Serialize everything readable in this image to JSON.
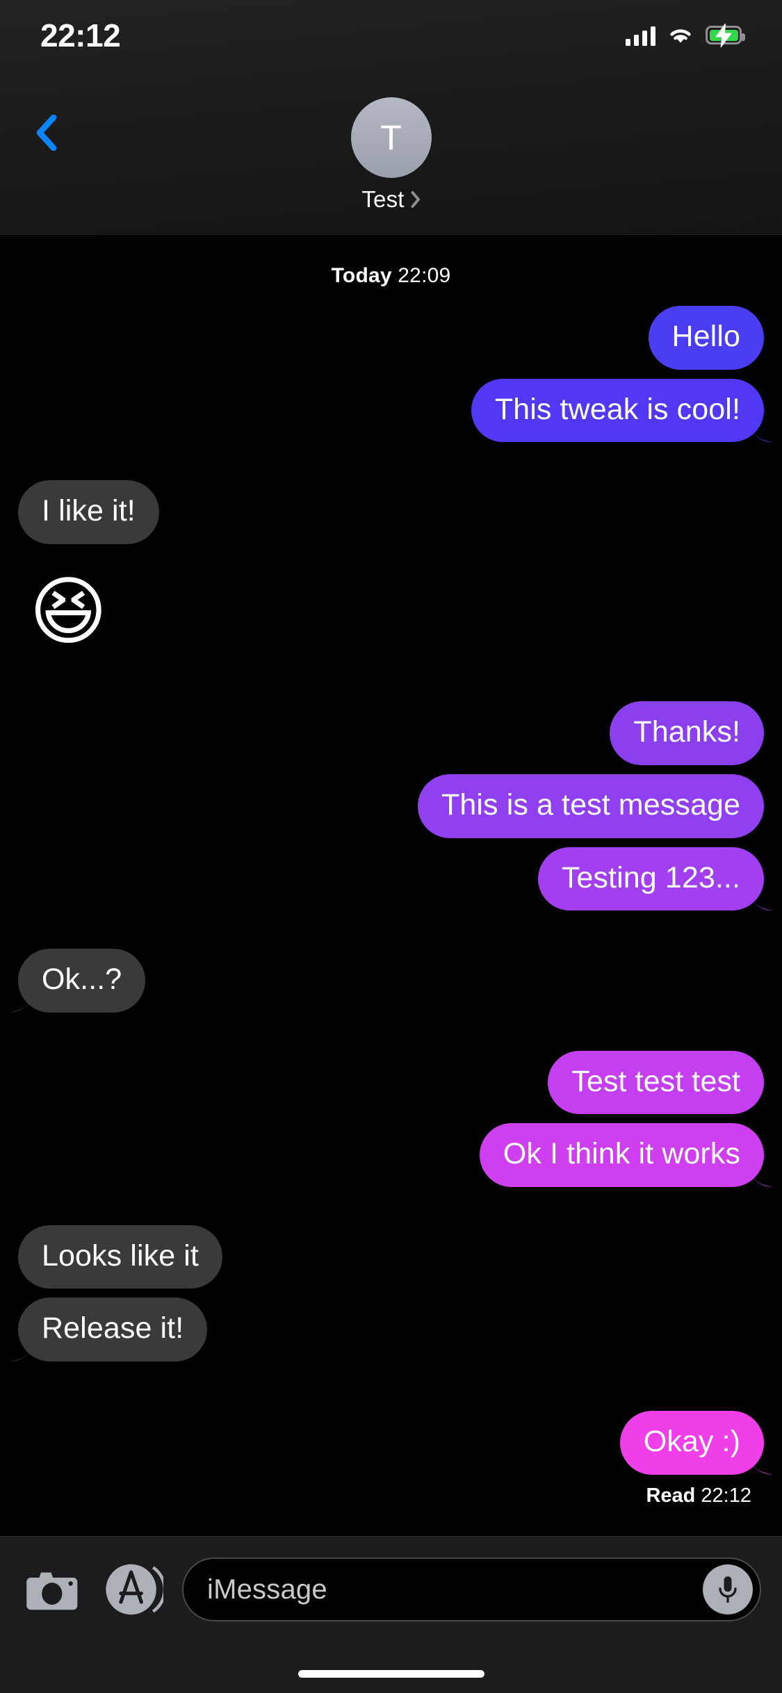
{
  "status_bar": {
    "time": "22:12",
    "signal_icon": "cellular-bars-icon",
    "wifi_icon": "wifi-icon",
    "battery_icon": "battery-charging-icon",
    "battery_color": "#32D74B",
    "signal_bars": 4
  },
  "nav_bar": {
    "back_icon": "chevron-left-icon",
    "back_color": "#0A84FF",
    "avatar_initial": "T",
    "contact_name": "Test",
    "disclosure_icon": "chevron-right-icon"
  },
  "conversation": {
    "day_label": "Today",
    "day_time": "22:09",
    "messages": [
      {
        "text": "Hello",
        "side": "out",
        "color": "#4B3DF2",
        "tail": false
      },
      {
        "text": "This tweak is cool!",
        "side": "out",
        "color": "#5138F5",
        "tail": true
      },
      {
        "text": "I like it!",
        "side": "in",
        "color": "#3A3A3C",
        "tail": false
      },
      {
        "text": "😆",
        "side": "in",
        "color": "",
        "tail": false,
        "emoji": true
      },
      {
        "text": "Thanks!",
        "side": "out",
        "color": "#8B3FEF",
        "tail": false
      },
      {
        "text": "This is a test message",
        "side": "out",
        "color": "#9040F0",
        "tail": false
      },
      {
        "text": "Testing 123...",
        "side": "out",
        "color": "#A23FF0",
        "tail": true
      },
      {
        "text": "Ok...?",
        "side": "in",
        "color": "#3A3A3C",
        "tail": true
      },
      {
        "text": "Test test test",
        "side": "out",
        "color": "#C43FF0",
        "tail": false
      },
      {
        "text": "Ok I think it works",
        "side": "out",
        "color": "#CE3FF0",
        "tail": true
      },
      {
        "text": "Looks like it",
        "side": "in",
        "color": "#3A3A3C",
        "tail": false
      },
      {
        "text": "Release it!",
        "side": "in",
        "color": "#3A3A3C",
        "tail": true
      },
      {
        "text": "Okay :)",
        "side": "out",
        "color": "#F03FE8",
        "tail": true
      }
    ],
    "receipt_label": "Read",
    "receipt_time": "22:12"
  },
  "toolbar": {
    "camera_icon": "camera-icon",
    "appstore_icon": "app-store-icon",
    "input_placeholder": "iMessage",
    "mic_icon": "microphone-icon"
  }
}
